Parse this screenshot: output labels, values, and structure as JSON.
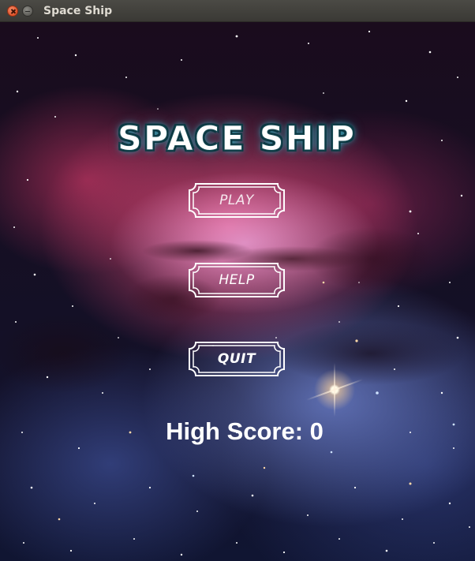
{
  "window": {
    "title": "Space Ship"
  },
  "game": {
    "logo_text": "SPACE SHIP",
    "menu": {
      "play_label": "PLAY",
      "help_label": "HELP",
      "quit_label": "QUIT"
    },
    "high_score_label": "High Score: 0"
  },
  "colors": {
    "logo_glow": "#43b8cc",
    "text": "#ffffff",
    "nebula_pink": "#de4876",
    "nebula_blue": "#6e82cd"
  }
}
